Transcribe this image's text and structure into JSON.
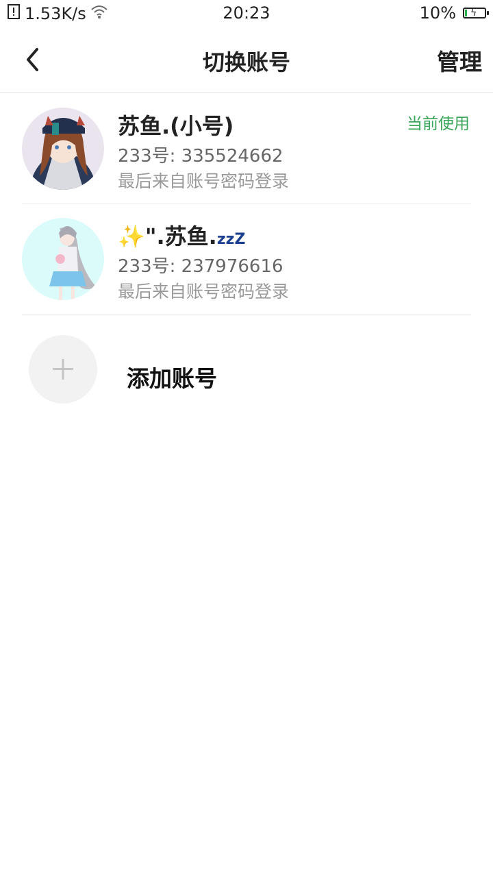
{
  "status_bar": {
    "speed": "1.53K/s",
    "time": "20:23",
    "battery_percent": "10%",
    "battery_level": 0.1
  },
  "header": {
    "back_icon": "chevron-left-icon",
    "title": "切换账号",
    "manage_label": "管理"
  },
  "accounts": [
    {
      "name": "苏鱼.(小号)",
      "id_text": "233号: 335524662",
      "login_text": "最后来自账号密码登录",
      "badge": "当前使用"
    },
    {
      "name_prefix": "✨\".苏鱼.",
      "name_suffix": "zzZ",
      "id_text": "233号: 237976616",
      "login_text": "最后来自账号密码登录"
    }
  ],
  "add_account": {
    "label": "添加账号",
    "icon": "plus-icon"
  },
  "colors": {
    "accent_green": "#3aa558",
    "divider": "#ebebeb"
  }
}
